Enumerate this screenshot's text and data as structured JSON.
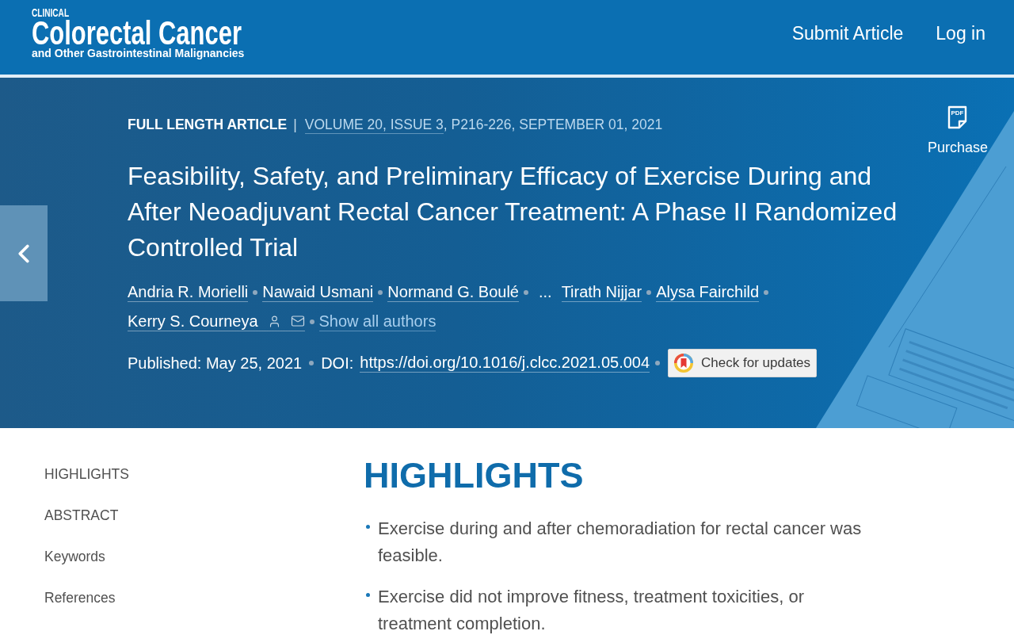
{
  "header": {
    "logo": {
      "kicker": "CLINICAL",
      "title": "Colorectal Cancer",
      "subtitle": "and Other Gastrointestinal Malignancies"
    },
    "nav": [
      "Submit Article",
      "Log in"
    ]
  },
  "article": {
    "type": "FULL LENGTH ARTICLE",
    "divider": "|",
    "issue_link": "VOLUME 20, ISSUE 3",
    "issue_rest": ", P216-226, SEPTEMBER 01, 2021",
    "title": "Feasibility, Safety, and Preliminary Efficacy of Exercise During and After Neoadjuvant Rectal Cancer Treatment: A Phase II Randomized Controlled Trial",
    "authors": [
      {
        "kind": "author",
        "name": "Andria R. Morielli",
        "corresponding": false
      },
      {
        "kind": "author",
        "name": "Nawaid Usmani",
        "corresponding": false
      },
      {
        "kind": "author",
        "name": "Normand G. Boulé",
        "corresponding": false
      },
      {
        "kind": "ellipsis",
        "name": "..."
      },
      {
        "kind": "author",
        "name": "Tirath Nijjar",
        "corresponding": false
      },
      {
        "kind": "author",
        "name": "Alysa Fairchild",
        "corresponding": false
      },
      {
        "kind": "author",
        "name": "Kerry S. Courneya",
        "corresponding": true
      }
    ],
    "show_all": "Show all authors",
    "published": "Published: May 25, 2021",
    "doi_label": "DOI:",
    "doi": "https://doi.org/10.1016/j.clcc.2021.05.004",
    "updates_button": "Check for updates"
  },
  "purchase": {
    "icon_text": "PDF",
    "label": "Purchase"
  },
  "outline": [
    "HIGHLIGHTS",
    "ABSTRACT",
    "Keywords",
    "References"
  ],
  "highlights": {
    "heading": "HIGHLIGHTS",
    "items": [
      "Exercise during and after chemoradiation for rectal cancer was feasible.",
      "Exercise did not improve fitness, treatment toxicities, or treatment completion."
    ]
  }
}
